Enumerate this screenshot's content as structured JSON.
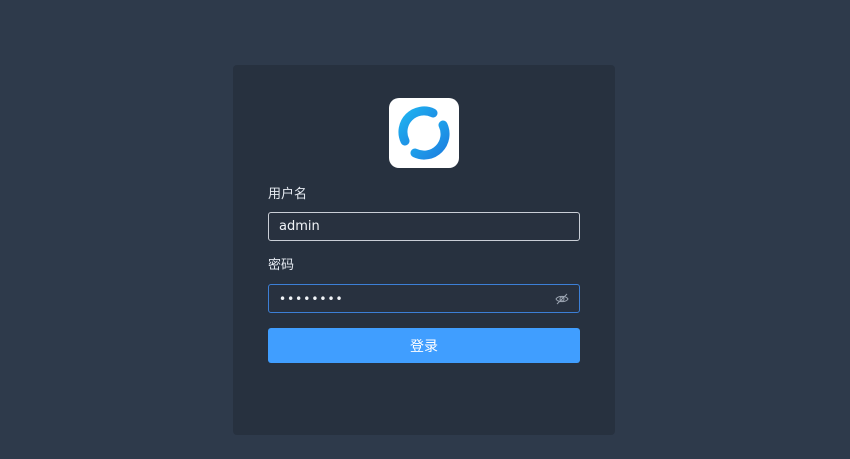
{
  "login": {
    "username_label": "用户名",
    "username_value": "admin",
    "password_label": "密码",
    "password_value": "••••••••",
    "submit_label": "登录"
  },
  "icons": {
    "logo": "app-logo-icon",
    "password_toggle": "eye-off-icon"
  },
  "colors": {
    "background": "#2e3a4b",
    "card": "#27313f",
    "primary": "#409eff",
    "focus_border": "#3c7fd6"
  }
}
